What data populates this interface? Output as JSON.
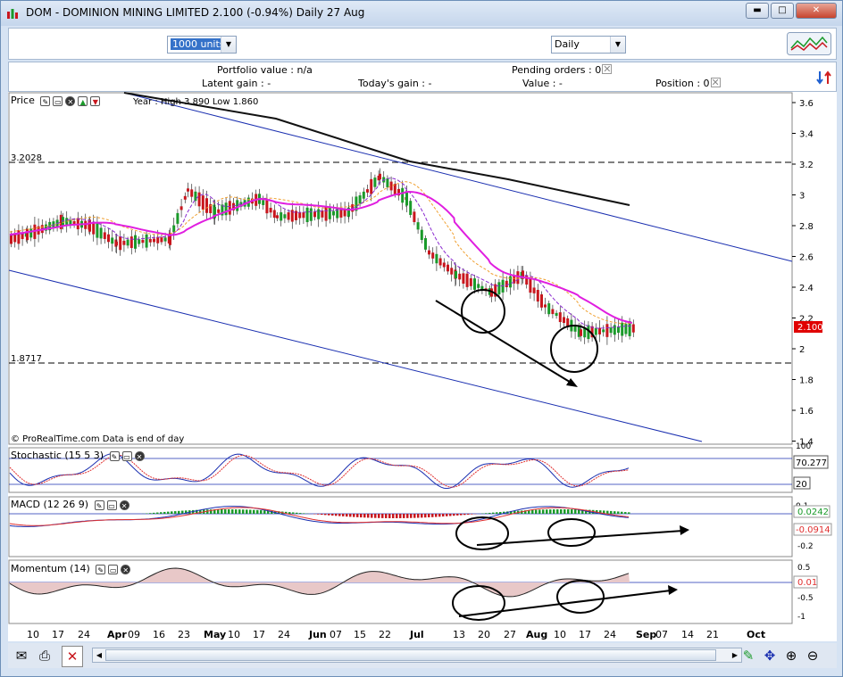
{
  "window": {
    "title": "DOM - DOMINION MINING LIMITED   2.100 (-0.94%)   Daily  27 Aug",
    "min": "▬",
    "max": "□",
    "close": "✕"
  },
  "toolbar": {
    "units": "1000 units",
    "period": "Daily"
  },
  "info": {
    "portfolio_label": "Portfolio value :",
    "portfolio_value": "n/a",
    "pending_label": "Pending orders :",
    "pending_value": "0",
    "latent_label": "Latent gain :",
    "latent_value": "-",
    "today_label": "Today's gain :",
    "today_value": "-",
    "value_label": "Value :",
    "value_value": "-",
    "position_label": "Position :",
    "position_value": "0"
  },
  "price_panel": {
    "name": "Price",
    "year_info": "Year : High 3.890 Low 1.860",
    "level_high": "3.2028",
    "level_low": "1.8717",
    "current": "2.100",
    "copyright": "© ProRealTime.com  Data is end of day",
    "y_ticks": [
      "3.6",
      "3.4",
      "3.2",
      "3",
      "2.8",
      "2.6",
      "2.4",
      "2.2",
      "2",
      "1.8",
      "1.6",
      "1.4"
    ]
  },
  "stoch_panel": {
    "name": "Stochastic (15 5 3)",
    "value": "70.277",
    "low": "20",
    "high": "100"
  },
  "macd_panel": {
    "name": "MACD (12 26 9)",
    "v1": "0.0242",
    "v2": "-0.0914",
    "ticks": [
      "0.1",
      "-0.1",
      "-0.2"
    ]
  },
  "mom_panel": {
    "name": "Momentum (14)",
    "value": "0.01",
    "ticks": [
      "0.5",
      "-0.5",
      "-1"
    ]
  },
  "x_axis": [
    "10",
    "17",
    "24",
    "Apr",
    "09",
    "16",
    "23",
    "May",
    "10",
    "17",
    "24",
    "Jun",
    "07",
    "15",
    "22",
    "Jul",
    "13",
    "20",
    "27",
    "Aug",
    "10",
    "17",
    "24",
    "Sep",
    "07",
    "14",
    "21",
    "Oct"
  ],
  "colors": {
    "up": "#1a9a2a",
    "down": "#c8161d",
    "ma_magenta": "#e01ee0",
    "ma_orange": "#f0a030",
    "ma_purple": "#8a2ad0",
    "trend": "#1a2fb0"
  },
  "icons": {
    "envelope": "envelope-icon",
    "printer": "printer-icon",
    "zoom_in": "zoom-in-icon",
    "zoom_out": "zoom-out-icon"
  }
}
